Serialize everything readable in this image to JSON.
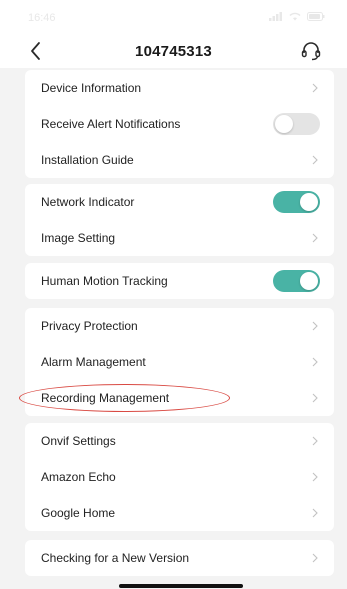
{
  "status_bar": {
    "time": "16:46"
  },
  "header": {
    "title": "104745313",
    "back_icon": "chevron-left-icon",
    "support_icon": "headset-icon"
  },
  "colors": {
    "toggle_on": "#49b3a5",
    "toggle_off": "#e4e4e4",
    "annotation": "#d94a43",
    "background": "#f3f3f3"
  },
  "groups": [
    {
      "items": [
        {
          "label": "Device Information",
          "control": "chevron"
        },
        {
          "label": "Receive Alert Notifications",
          "control": "toggle",
          "on": false
        },
        {
          "label": "Installation Guide",
          "control": "chevron"
        }
      ]
    },
    {
      "items": [
        {
          "label": "Network Indicator",
          "control": "toggle",
          "on": true
        },
        {
          "label": "Image Setting",
          "control": "chevron"
        }
      ]
    },
    {
      "items": [
        {
          "label": "Human Motion Tracking",
          "control": "toggle",
          "on": true
        }
      ]
    },
    {
      "items": [
        {
          "label": "Privacy Protection",
          "control": "chevron"
        },
        {
          "label": "Alarm Management",
          "control": "chevron"
        },
        {
          "label": "Recording Management",
          "control": "chevron"
        }
      ]
    },
    {
      "items": [
        {
          "label": "Onvif Settings",
          "control": "chevron"
        },
        {
          "label": "Amazon Echo",
          "control": "chevron"
        },
        {
          "label": "Google Home",
          "control": "chevron"
        }
      ]
    },
    {
      "items": [
        {
          "label": "Checking for a New Version",
          "control": "chevron"
        }
      ]
    }
  ]
}
